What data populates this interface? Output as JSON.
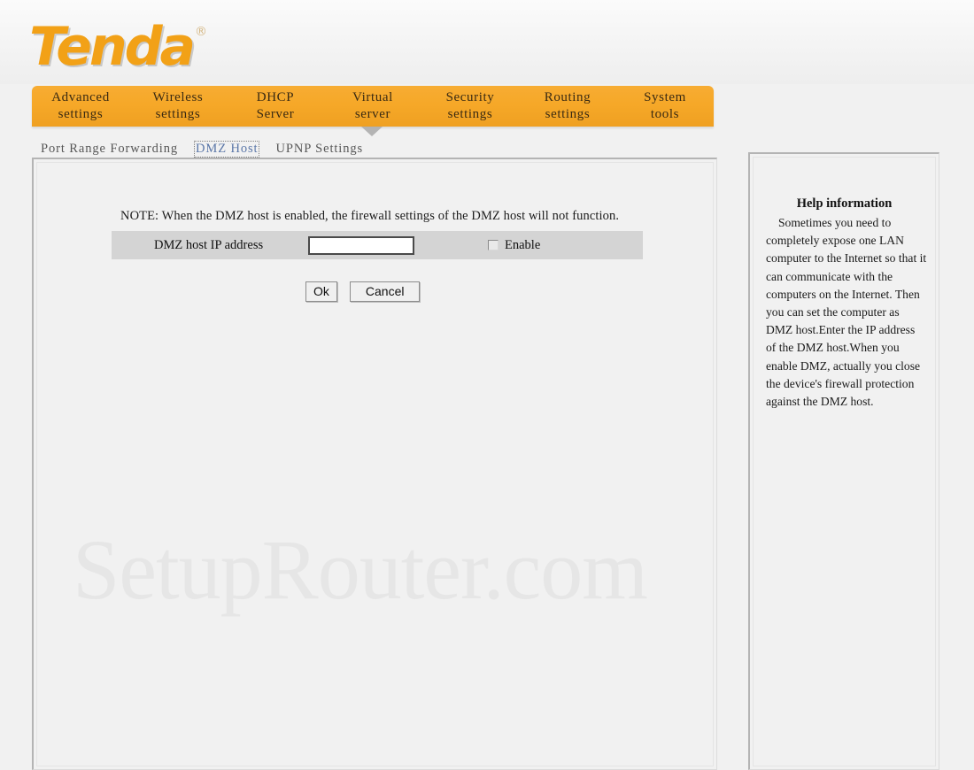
{
  "brand": {
    "name": "Tenda",
    "trademark": "®",
    "logo_color": "#F2A117"
  },
  "nav": {
    "accent_color": "#F6A828",
    "items": [
      {
        "line1": "Advanced",
        "line2": "settings"
      },
      {
        "line1": "Wireless",
        "line2": "settings"
      },
      {
        "line1": "DHCP",
        "line2": "Server"
      },
      {
        "line1": "Virtual",
        "line2": "server"
      },
      {
        "line1": "Security",
        "line2": "settings"
      },
      {
        "line1": "Routing",
        "line2": "settings"
      },
      {
        "line1": "System",
        "line2": "tools"
      }
    ],
    "active_index": 3
  },
  "subnav": {
    "items": [
      {
        "label": "Port Range Forwarding",
        "active": false
      },
      {
        "label": "DMZ Host",
        "active": true
      },
      {
        "label": "UPNP Settings",
        "active": false
      }
    ],
    "active_color": "#5B77A8"
  },
  "main": {
    "note": "NOTE: When the DMZ host is enabled, the firewall settings of the DMZ host will not function.",
    "row": {
      "label": "DMZ host IP address",
      "input_value": "",
      "input_placeholder": "",
      "enable_label": "Enable",
      "enable_checked": false,
      "row_background": "#D4D4D4"
    },
    "buttons": {
      "ok": "Ok",
      "cancel": "Cancel"
    }
  },
  "help": {
    "title": "Help information",
    "text": "Sometimes you need to completely expose one LAN computer to the Internet so that it can communicate with the computers on the Internet. Then you can set the computer as DMZ host.Enter the IP address of the DMZ host.When you enable DMZ, actually you close the device's firewall protection against the DMZ host."
  },
  "watermark": {
    "text": "SetupRouter.com"
  }
}
